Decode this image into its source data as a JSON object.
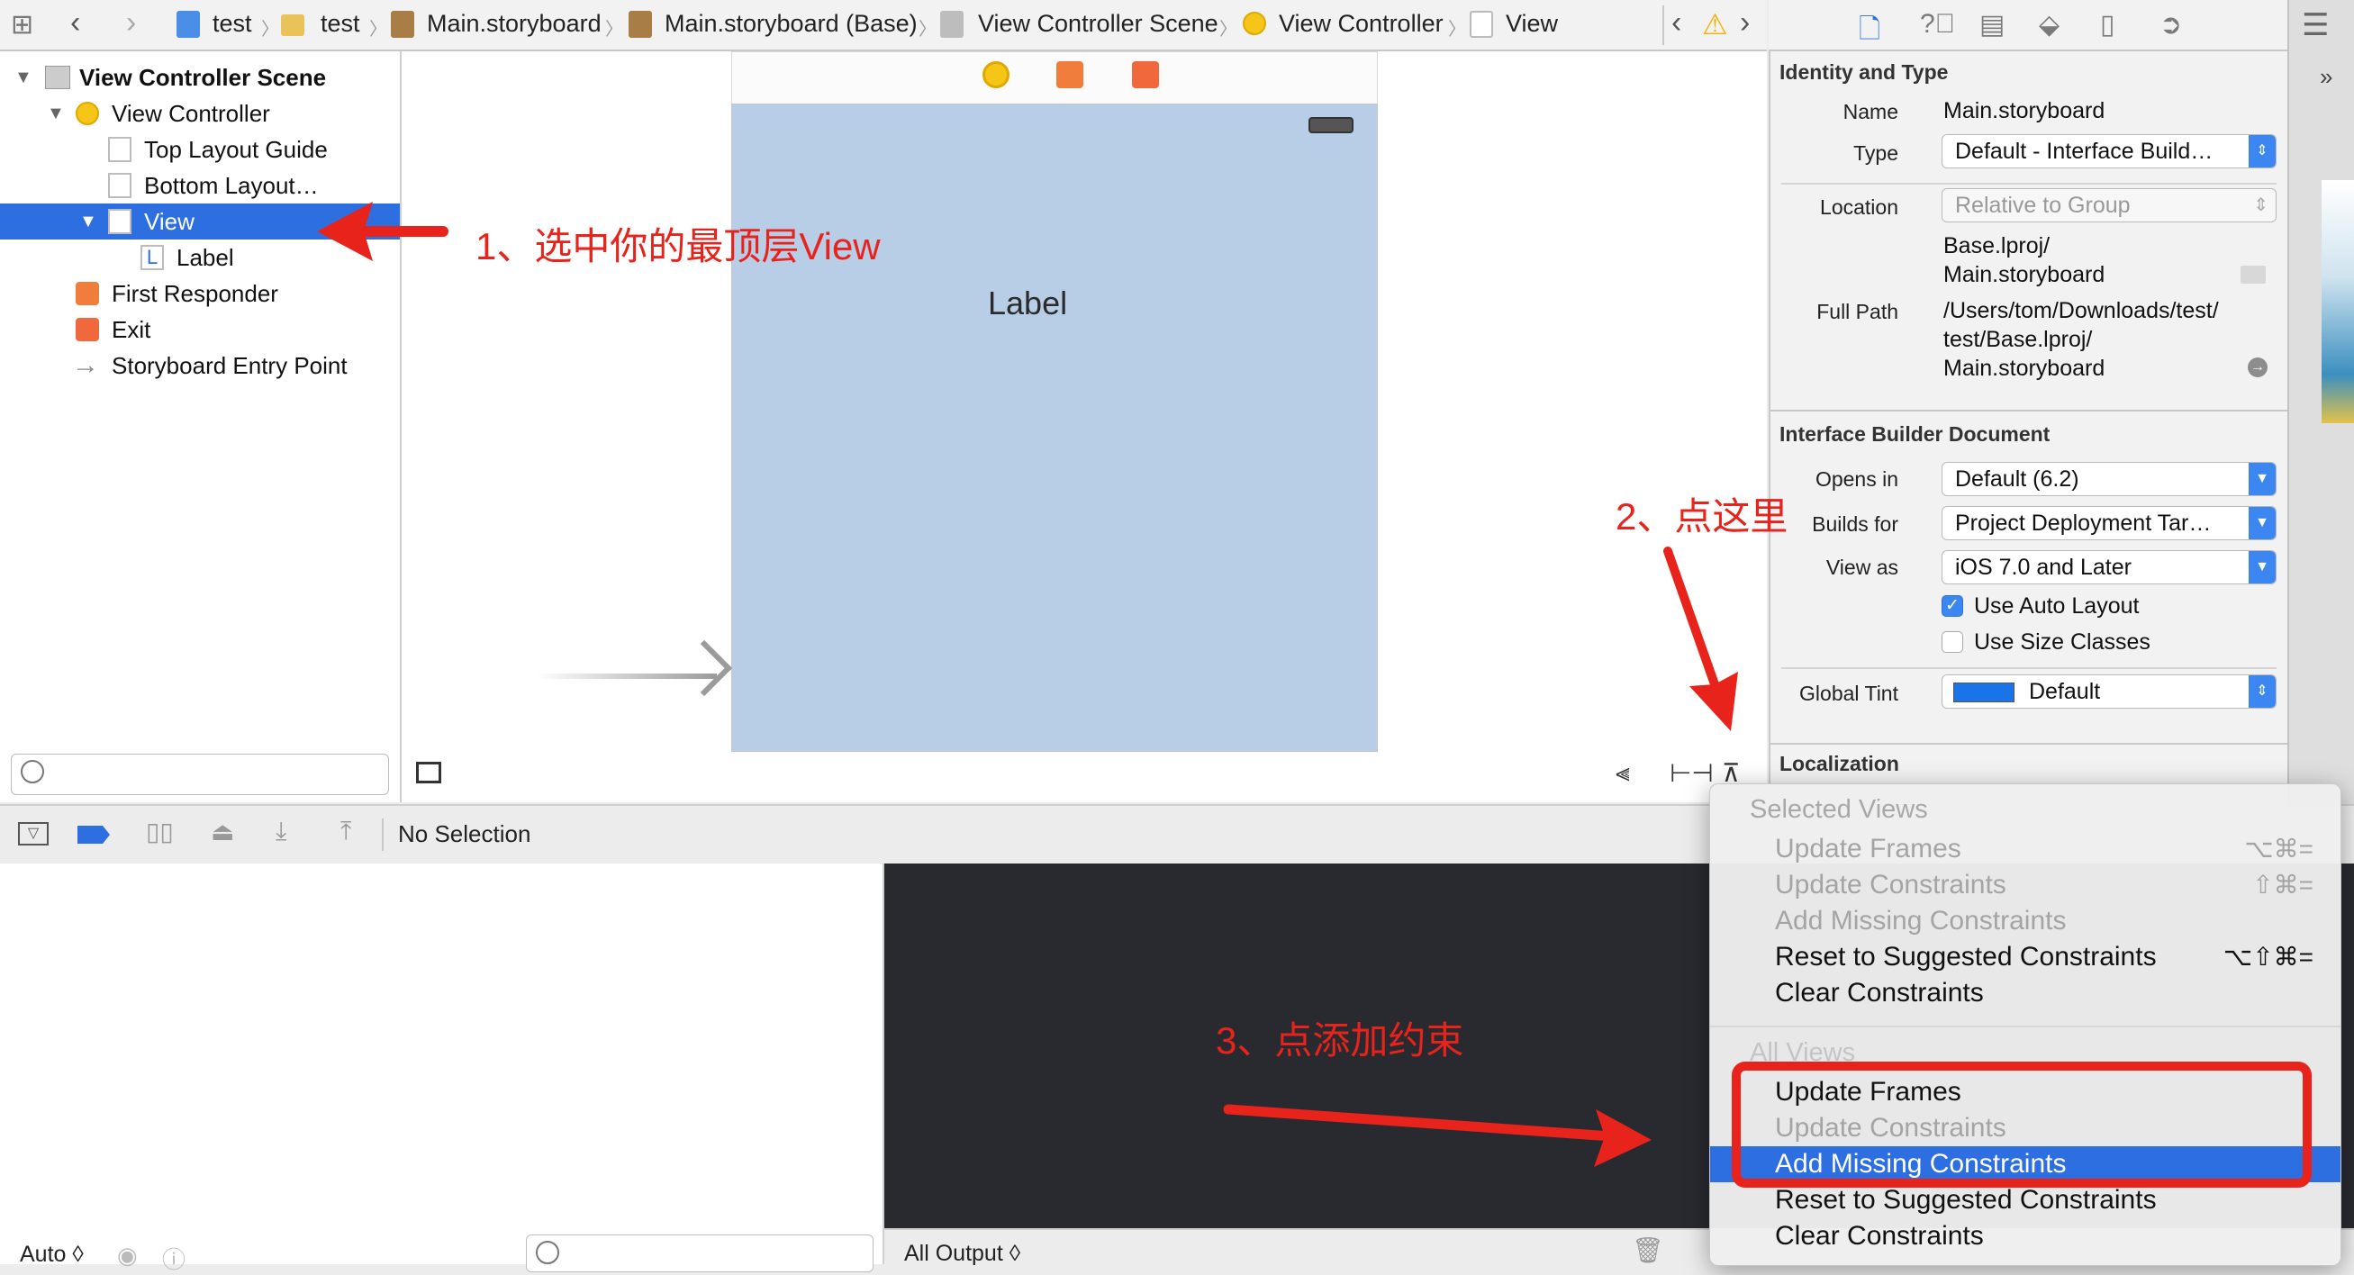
{
  "breadcrumb": {
    "items": [
      "test",
      "test",
      "Main.storyboard",
      "Main.storyboard (Base)",
      "View Controller Scene",
      "View Controller",
      "View"
    ]
  },
  "outline": {
    "rows": [
      {
        "label": "View Controller Scene",
        "bold": true
      },
      {
        "label": "View Controller"
      },
      {
        "label": "Top Layout Guide"
      },
      {
        "label": "Bottom Layout…"
      },
      {
        "label": "View",
        "selected": true
      },
      {
        "label": "Label"
      },
      {
        "label": "First Responder"
      },
      {
        "label": "Exit"
      },
      {
        "label": "Storyboard Entry Point"
      }
    ],
    "filter_placeholder": ""
  },
  "canvas": {
    "label_text": "Label"
  },
  "inspector": {
    "identity": {
      "title": "Identity and Type",
      "name_label": "Name",
      "name_value": "Main.storyboard",
      "type_label": "Type",
      "type_value": "Default - Interface Build…",
      "location_label": "Location",
      "location_value": "Relative to Group",
      "location_path_1": "Base.lproj/",
      "location_path_2": "Main.storyboard",
      "fullpath_label": "Full Path",
      "fullpath_1": "/Users/tom/Downloads/test/",
      "fullpath_2": "test/Base.lproj/",
      "fullpath_3": "Main.storyboard"
    },
    "ibdoc": {
      "title": "Interface Builder Document",
      "opens_label": "Opens in",
      "opens_value": "Default (6.2)",
      "builds_label": "Builds for",
      "builds_value": "Project Deployment Tar…",
      "viewas_label": "View as",
      "viewas_value": "iOS 7.0 and Later",
      "autolayout_label": "Use Auto Layout",
      "autolayout_checked": true,
      "sizeclasses_label": "Use Size Classes",
      "sizeclasses_checked": false,
      "tint_label": "Global Tint",
      "tint_value": "Default",
      "tint_color": "#1a73e8"
    },
    "localization_title": "Localization"
  },
  "debug": {
    "selection_text": "No Selection",
    "var_scope": "Auto ◊",
    "console_scope": "All Output ◊"
  },
  "menu": {
    "header_selected": "Selected Views",
    "header_all": "All Views",
    "selected_items": [
      {
        "label": "Update Frames",
        "shortcut": "⌥⌘=",
        "enabled": false
      },
      {
        "label": "Update Constraints",
        "shortcut": "⇧⌘=",
        "enabled": false
      },
      {
        "label": "Add Missing Constraints",
        "shortcut": "",
        "enabled": false
      },
      {
        "label": "Reset to Suggested Constraints",
        "shortcut": "⌥⇧⌘=",
        "enabled": true
      },
      {
        "label": "Clear Constraints",
        "shortcut": "",
        "enabled": true
      }
    ],
    "all_items": [
      {
        "label": "Update Frames",
        "enabled": true
      },
      {
        "label": "Update Constraints",
        "enabled": false
      },
      {
        "label": "Add Missing Constraints",
        "enabled": true,
        "highlighted": true
      },
      {
        "label": "Reset to Suggested Constraints",
        "enabled": true
      },
      {
        "label": "Clear Constraints",
        "enabled": true
      }
    ]
  },
  "annotations": {
    "step1": "1、选中你的最顶层View",
    "step2": "2、点这里",
    "step3": "3、点添加约束"
  },
  "colors": {
    "accent": "#2d6fe0",
    "annotation": "#e8231b",
    "device_bg": "#b8cde6",
    "console_bg": "#292a30"
  }
}
